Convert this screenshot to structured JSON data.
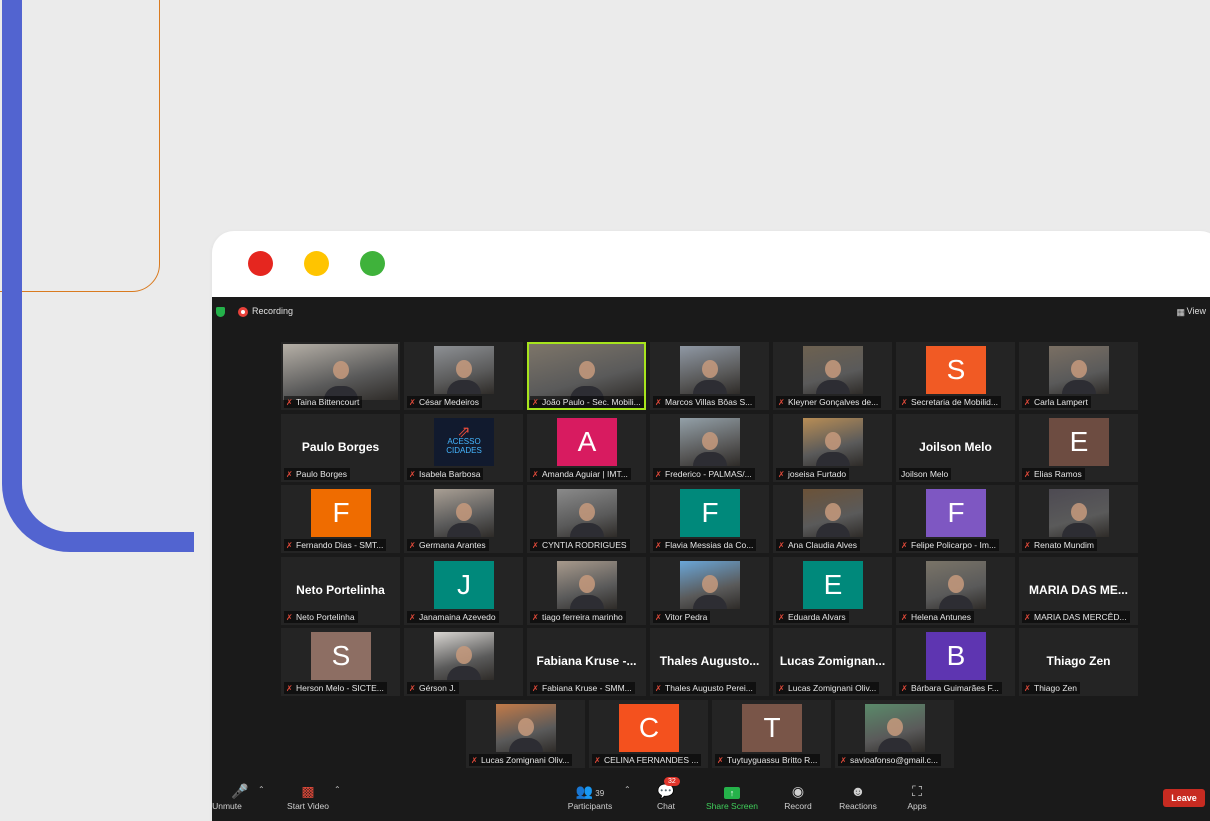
{
  "recording_label": "Recording",
  "view_label": "View",
  "participants": [
    {
      "name": "Taina Bittencourt",
      "kind": "photo",
      "photo_bg": "#b6b0a7"
    },
    {
      "name": "César Medeiros",
      "kind": "photo",
      "photo_bg": "#8d9094"
    },
    {
      "name": "João Paulo - Sec. Mobili...",
      "kind": "photo",
      "photo_bg": "#7d7569",
      "speaking": true
    },
    {
      "name": "Marcos Villas Bôas S...",
      "kind": "photo",
      "photo_bg": "#8f98a4"
    },
    {
      "name": "Kleyner Gonçalves de...",
      "kind": "photo",
      "photo_bg": "#6d6150"
    },
    {
      "name": "Secretaria de Mobilid...",
      "kind": "avatar",
      "letter": "S",
      "color": "#f15a24"
    },
    {
      "name": "Carla Lampert",
      "kind": "photo",
      "photo_bg": "#7a6f63"
    },
    {
      "name": "Paulo Borges",
      "kind": "name",
      "display": "Paulo Borges"
    },
    {
      "name": "Isabela Barbosa",
      "kind": "logo",
      "logo_text": "ACESSO CIDADES"
    },
    {
      "name": "Amanda Aguiar | IMT...",
      "kind": "avatar",
      "letter": "A",
      "color": "#d81b60"
    },
    {
      "name": "Frederico - PALMAS/...",
      "kind": "photo",
      "photo_bg": "#93a0a8"
    },
    {
      "name": "joseisa Furtado",
      "kind": "photo",
      "photo_bg": "#b88d55"
    },
    {
      "name": "Joilson Melo",
      "kind": "name",
      "display": "Joilson Melo"
    },
    {
      "name": "Elias Ramos",
      "kind": "avatar",
      "letter": "E",
      "color": "#6d4c41"
    },
    {
      "name": "Fernando Dias - SMT...",
      "kind": "avatar",
      "letter": "F",
      "color": "#ef6c00"
    },
    {
      "name": "Germana Arantes",
      "kind": "photo",
      "photo_bg": "#a99f94"
    },
    {
      "name": "CYNTIA RODRIGUES",
      "kind": "photo",
      "photo_bg": "#8a8a8a"
    },
    {
      "name": "Flavia Messias da Co...",
      "kind": "avatar",
      "letter": "F",
      "color": "#00897b"
    },
    {
      "name": "Ana Claudia Alves",
      "kind": "photo",
      "photo_bg": "#6b5238"
    },
    {
      "name": "Felipe Policarpo - Im...",
      "kind": "avatar",
      "letter": "F",
      "color": "#7e57c2"
    },
    {
      "name": "Renato Mundim",
      "kind": "photo",
      "photo_bg": "#4d4a52"
    },
    {
      "name": "Neto Portelinha",
      "kind": "name",
      "display": "Neto Portelinha"
    },
    {
      "name": "Janamaina Azevedo",
      "kind": "avatar",
      "letter": "J",
      "color": "#00897b"
    },
    {
      "name": "tiago ferreira marinho",
      "kind": "photo",
      "photo_bg": "#a89a8c"
    },
    {
      "name": "Vitor Pedra",
      "kind": "photo",
      "photo_bg": "#6aa6d8"
    },
    {
      "name": "Eduarda Alvars",
      "kind": "avatar",
      "letter": "E",
      "color": "#00897b"
    },
    {
      "name": "Helena Antunes",
      "kind": "photo",
      "photo_bg": "#7a7468"
    },
    {
      "name": "MARIA DAS MERCÊD...",
      "kind": "name",
      "display": "MARIA DAS ME..."
    },
    {
      "name": "Herson Melo - SICTE...",
      "kind": "avatar",
      "letter": "S",
      "color": "#8d6e63"
    },
    {
      "name": "Gérson J.",
      "kind": "photo",
      "photo_bg": "#d9d6d2"
    },
    {
      "name": "Fabiana Kruse - SMM...",
      "kind": "name",
      "display": "Fabiana Kruse -..."
    },
    {
      "name": "Thales Augusto Perei...",
      "kind": "name",
      "display": "Thales Augusto..."
    },
    {
      "name": "Lucas Zomignani Oliv...",
      "kind": "name",
      "display": "Lucas Zomignan..."
    },
    {
      "name": "Bárbara Guimarães F...",
      "kind": "avatar",
      "letter": "B",
      "color": "#5e35b1"
    },
    {
      "name": "Thiago Zen",
      "kind": "name",
      "display": "Thiago Zen"
    },
    {
      "name": "Lucas Zomignani Oliv...",
      "kind": "photo",
      "photo_bg": "#c27a48"
    },
    {
      "name": "CELINA FERNANDES ...",
      "kind": "avatar",
      "letter": "C",
      "color": "#f4511e"
    },
    {
      "name": "Tuytuyguassu Britto R...",
      "kind": "avatar",
      "letter": "T",
      "color": "#795548"
    },
    {
      "name": "savioafonso@gmail.c...",
      "kind": "photo",
      "photo_bg": "#5a8a6a"
    }
  ],
  "controls": {
    "unmute": "Unmute",
    "start_video": "Start Video",
    "participants": "Participants",
    "participants_count": "39",
    "chat": "Chat",
    "chat_badge": "32",
    "share_screen": "Share Screen",
    "record": "Record",
    "reactions": "Reactions",
    "apps": "Apps",
    "leave": "Leave"
  },
  "colors": {
    "page_bg": "#ebebeb",
    "accent_blue": "#5264d0",
    "accent_orange": "#d97a1f",
    "meeting_bg": "#1a1a1a",
    "tile_bg": "#242424",
    "speaking_border": "#a7e41d",
    "leave_red": "#c72b21",
    "share_green": "#25b24a"
  }
}
